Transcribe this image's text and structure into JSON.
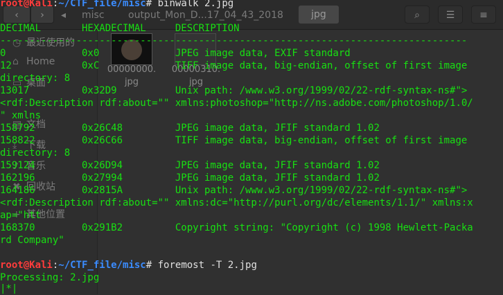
{
  "file_manager": {
    "path_segments": [
      "misc",
      "output_Mon_D...17_04_43_2018"
    ],
    "current_folder": "jpg",
    "sidebar_items": [
      {
        "label": "最近使用的",
        "icon": "clock-icon"
      },
      {
        "label": "Home",
        "icon": "home-icon"
      },
      {
        "label": "桌面",
        "icon": "desktop-icon"
      },
      {
        "label": "文档",
        "icon": "document-icon"
      },
      {
        "label": "下载",
        "icon": "download-icon"
      },
      {
        "label": "音乐",
        "icon": "music-icon"
      },
      {
        "label": "回收站",
        "icon": "trash-icon"
      },
      {
        "label": "其他位置",
        "icon": "plus-icon"
      }
    ],
    "files": [
      {
        "name_line1": "00000000.",
        "name_line2": "jpg"
      },
      {
        "name_line1": "00000310.",
        "name_line2": "jpg"
      }
    ]
  },
  "terminal": {
    "prompt": {
      "user_host": "root@Kali",
      "separator": ":",
      "path": "~/CTF_file/misc",
      "symbol": "#"
    },
    "command1": " binwalk 2.jpg",
    "lines": [
      "DECIMAL       HEXADECIMAL     DESCRIPTION",
      "--------------------------------------------------------------------------------",
      "0             0x0             JPEG image data, EXIF standard",
      "12            0xC             TIFF image data, big-endian, offset of first image",
      "directory: 8",
      "13017         0x32D9          Unix path: /www.w3.org/1999/02/22-rdf-syntax-ns#\">",
      "<rdf:Description rdf:about=\"\" xmlns:photoshop=\"http://ns.adobe.com/photoshop/1.0/",
      "\" xmlns",
      "158792        0x26C48         JPEG image data, JFIF standard 1.02",
      "158822        0x26C66         TIFF image data, big-endian, offset of first image",
      "directory: 8",
      "159124        0x26D94         JPEG image data, JFIF standard 1.02",
      "162196        0x27994         JPEG image data, JFIF standard 1.02",
      "164186        0x2815A         Unix path: /www.w3.org/1999/02/22-rdf-syntax-ns#\">",
      "<rdf:Description rdf:about=\"\" xmlns:dc=\"http://purl.org/dc/elements/1.1/\" xmlns:x",
      "ap=\"htt",
      "168370        0x291B2         Copyright string: \"Copyright (c) 1998 Hewlett-Packa",
      "rd Company\"",
      ""
    ],
    "command2": " foremost -T 2.jpg",
    "output2": [
      "Processing: 2.jpg",
      "|*|"
    ]
  },
  "colors": {
    "terminal_green": "#18e012",
    "prompt_user": "#ff3c3c",
    "prompt_path": "#3b8cff",
    "background": "#303030"
  }
}
